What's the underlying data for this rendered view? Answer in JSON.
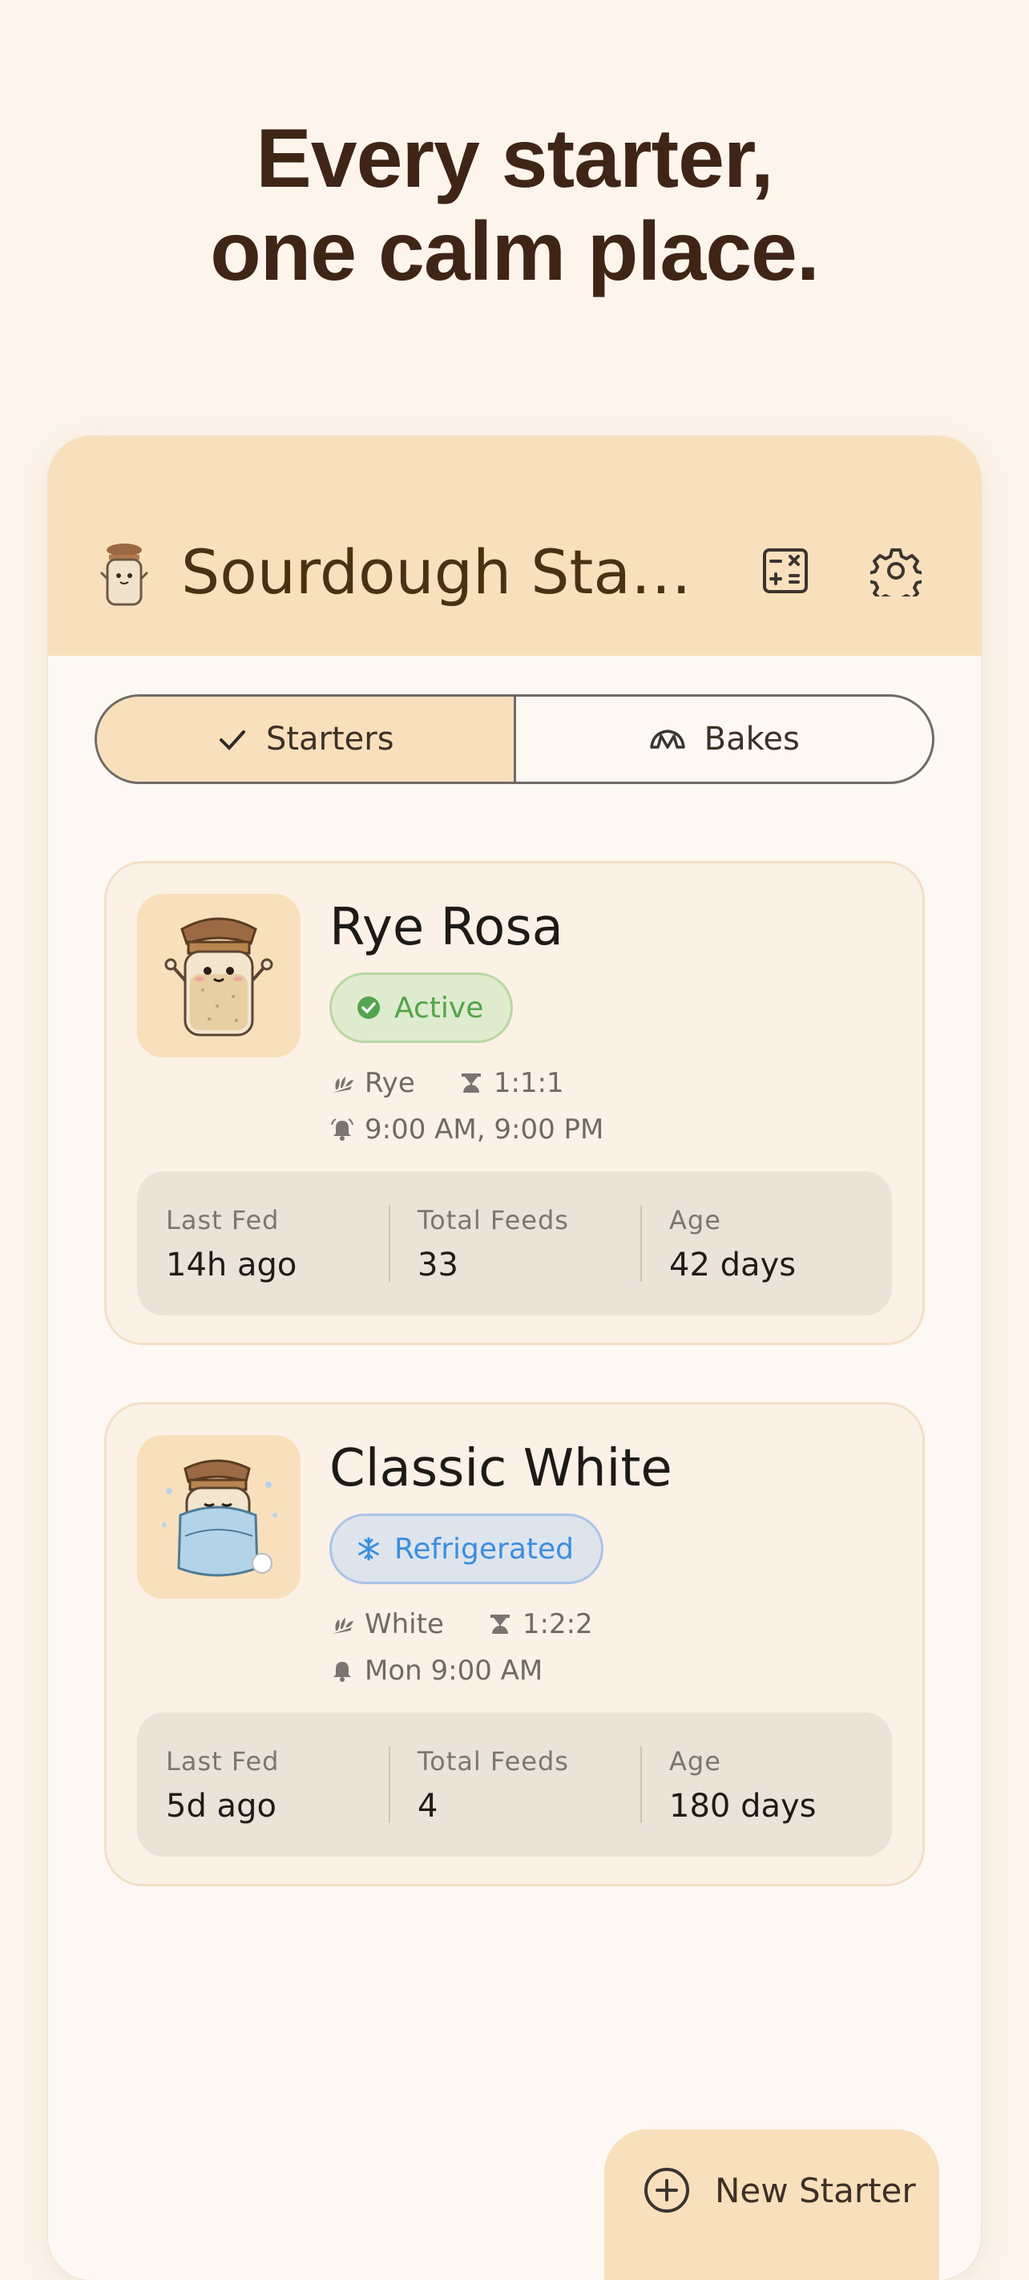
{
  "headline": {
    "line1": "Every starter,",
    "line2": "one calm place."
  },
  "app": {
    "title": "Sourdough Start...",
    "icons": {
      "logo": "jar-mascot-icon",
      "calculator": "calculator-icon",
      "settings": "gear-icon"
    }
  },
  "tabs": [
    {
      "label": "Starters",
      "icon": "check-icon",
      "selected": true
    },
    {
      "label": "Bakes",
      "icon": "croissant-icon",
      "selected": false
    }
  ],
  "starters": [
    {
      "name": "Rye Rosa",
      "status": "Active",
      "status_icon": "check-circle-icon",
      "flour": "Rye",
      "ratio": "1:1:1",
      "schedule": "9:00 AM, 9:00 PM",
      "stats": {
        "last_fed_label": "Last Fed",
        "last_fed": "14h ago",
        "total_feeds_label": "Total Feeds",
        "total_feeds": "33",
        "age_label": "Age",
        "age": "42 days"
      }
    },
    {
      "name": "Classic White",
      "status": "Refrigerated",
      "status_icon": "snowflake-icon",
      "flour": "White",
      "ratio": "1:2:2",
      "schedule": "Mon 9:00 AM",
      "stats": {
        "last_fed_label": "Last Fed",
        "last_fed": "5d ago",
        "total_feeds_label": "Total Feeds",
        "total_feeds": "4",
        "age_label": "Age",
        "age": "180 days"
      }
    }
  ],
  "fab": {
    "label": "New Starter",
    "icon": "plus-circle-icon"
  },
  "colors": {
    "background": "#fdf5ec",
    "appbar": "#f8e0bc",
    "headline": "#3f2516",
    "active_green": "#52a54a",
    "refrigerated_blue": "#3b8ee0"
  }
}
